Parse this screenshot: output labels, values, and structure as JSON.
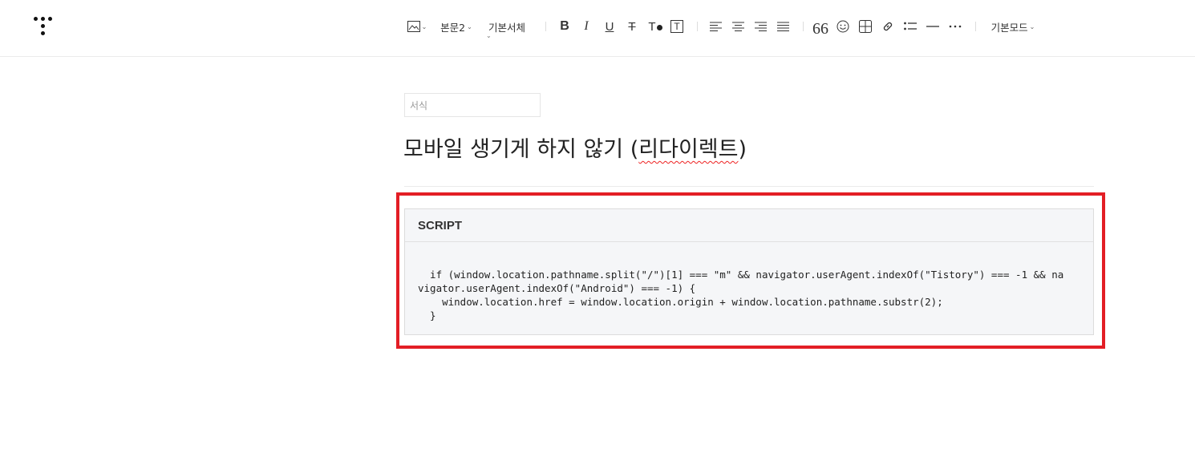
{
  "toolbar": {
    "paragraph_style": "본문2",
    "font_family": "기본서체",
    "mode": "기본모드",
    "icons": [
      "image-icon",
      "bold-icon",
      "italic-icon",
      "underline-icon",
      "strikethrough-icon",
      "text-color-icon",
      "text-background-icon",
      "align-left-icon",
      "align-center-icon",
      "align-right-icon",
      "align-justify-icon",
      "quote-icon",
      "emoji-icon",
      "table-icon",
      "link-icon",
      "list-icon",
      "horizontal-rule-icon",
      "more-icon"
    ]
  },
  "editor": {
    "category_placeholder": "서식",
    "title_prefix": "모바일 생기게 하지 않기 (",
    "title_spell": "리다이렉트",
    "title_suffix": ")"
  },
  "code_block": {
    "language": "SCRIPT",
    "lines": [
      "  if (window.location.pathname.split(\"/\")[1] === \"m\" && navigator.userAgent.indexOf(\"Tistory\") === -1 && na",
      "vigator.userAgent.indexOf(\"Android\") === -1) {",
      "    window.location.href = window.location.origin + window.location.pathname.substr(2);",
      "  }"
    ]
  },
  "colors": {
    "highlight": "#e31e25",
    "code_bg": "#f5f6f8"
  }
}
